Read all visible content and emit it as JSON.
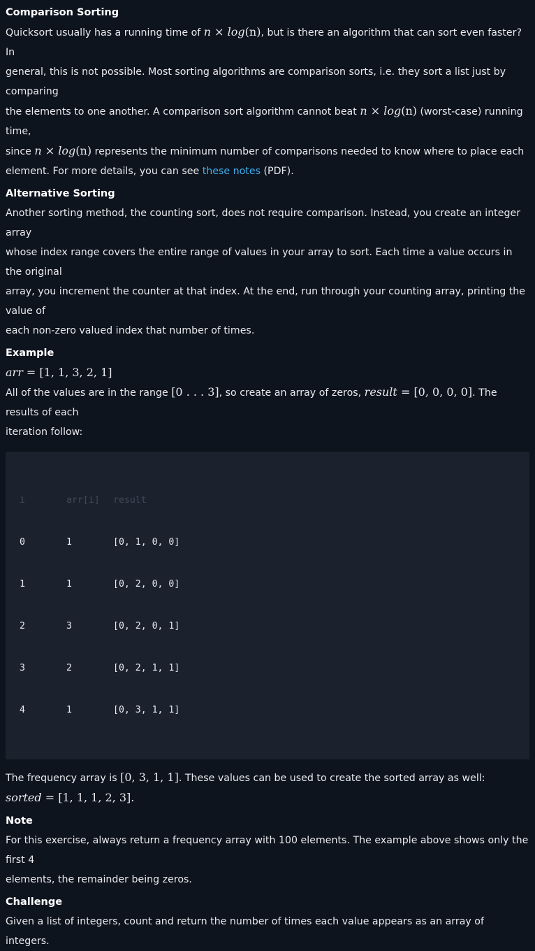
{
  "sections": {
    "comparison": {
      "title": "Comparison Sorting",
      "p1_a": "Quicksort usually has a running time of ",
      "p1_b": ", but is there an algorithm that can sort even faster? In",
      "p2": "general, this is not possible. Most sorting algorithms are comparison sorts, i.e. they sort a list just by comparing",
      "p3_a": "the elements to one another. A comparison sort algorithm cannot beat ",
      "p3_b": " (worst-case) running time,",
      "p4_a": "since ",
      "p4_b": " represents the minimum number of comparisons needed to know where to place each",
      "p5_a": "element. For more details, you can see ",
      "link": "these notes",
      "p5_b": " (PDF)."
    },
    "alternative": {
      "title": "Alternative Sorting",
      "lines": [
        "Another sorting method, the counting sort, does not require comparison. Instead, you create an integer array",
        "whose index range covers the entire range of values in your array to sort. Each time a value occurs in the original",
        "array, you increment the counter at that index. At the end, run through your counting array, printing the value of",
        "each non-zero valued index that number of times."
      ]
    },
    "example": {
      "title": "Example",
      "arr_var": "arr",
      "arr_val": " = [1, 1, 3, 2, 1]",
      "l1_a": "All of the values are in the range ",
      "range": "[0 . . . 3]",
      "l1_b": ", so create an array of zeros, ",
      "result_var": "result",
      "result_val": " = [0, 0, 0, 0]",
      "l1_c": ". The results of each",
      "l2": "iteration follow:"
    },
    "table": {
      "header": {
        "i": "i",
        "arr": "arr[i]",
        "result": "result"
      },
      "rows": [
        {
          "i": "0",
          "arr": "1",
          "result": "[0, 1, 0, 0]"
        },
        {
          "i": "1",
          "arr": "1",
          "result": "[0, 2, 0, 0]"
        },
        {
          "i": "2",
          "arr": "3",
          "result": "[0, 2, 0, 1]"
        },
        {
          "i": "3",
          "arr": "2",
          "result": "[0, 2, 1, 1]"
        },
        {
          "i": "4",
          "arr": "1",
          "result": "[0, 3, 1, 1]"
        }
      ]
    },
    "frequency": {
      "l1_a": "The frequency array is ",
      "freq": "[0, 3, 1, 1]",
      "l1_b": ". These values can be used to create the sorted array as well:",
      "sorted_var": "sorted",
      "sorted_val": " = [1, 1, 1, 2, 3]",
      "sorted_end": "."
    },
    "note": {
      "title": "Note",
      "lines": [
        "For this exercise, always return a frequency array with 100 elements. The example above shows only the first 4",
        "elements, the remainder being zeros."
      ]
    },
    "challenge": {
      "title": "Challenge",
      "text": "Given a list of integers, count and return the number of times each value appears as an array of integers."
    }
  },
  "math": {
    "nlogn_n": "n",
    "nlogn_x": " × ",
    "nlogn_log": "log",
    "nlogn_paren": "(n)"
  }
}
